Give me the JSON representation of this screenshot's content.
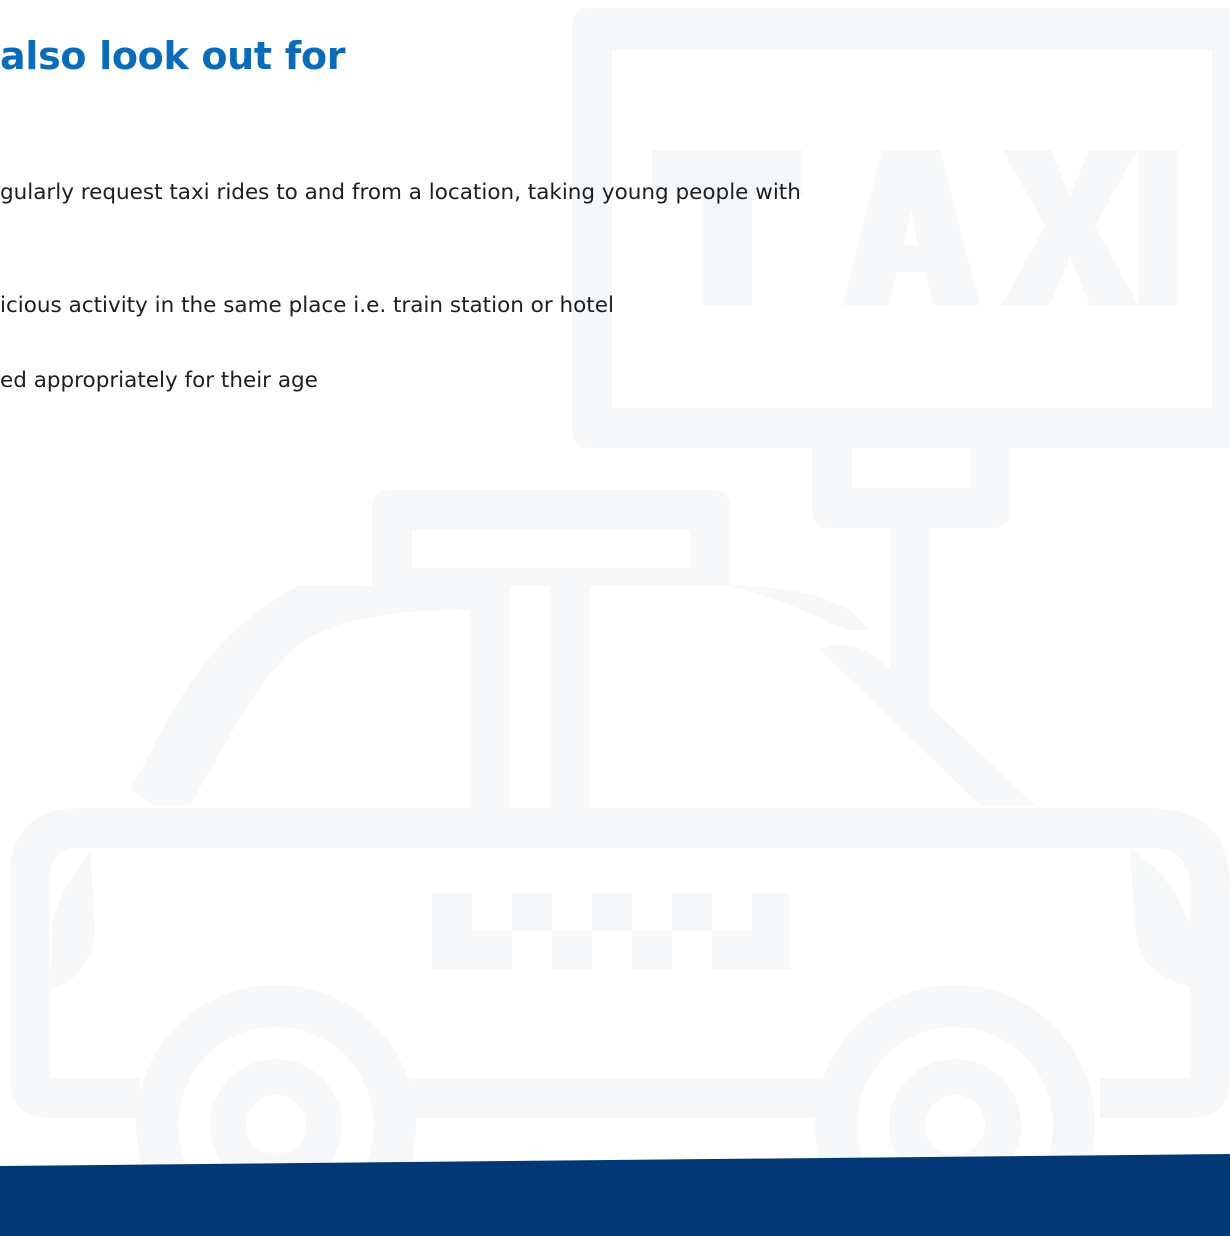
{
  "heading": "also look out for",
  "lines": [
    "gularly request taxi rides to and from a location, taking young people with",
    "icious activity in the same place i.e. train station or hotel",
    "ed appropriately for their age"
  ],
  "illustration": {
    "icon": "taxi-icon",
    "sign_text": "TAXI"
  },
  "colors": {
    "heading": "#0a6bb8",
    "body_text": "#1b1e22",
    "illustration": "#f6f7f8",
    "footer_band": "#023876"
  }
}
